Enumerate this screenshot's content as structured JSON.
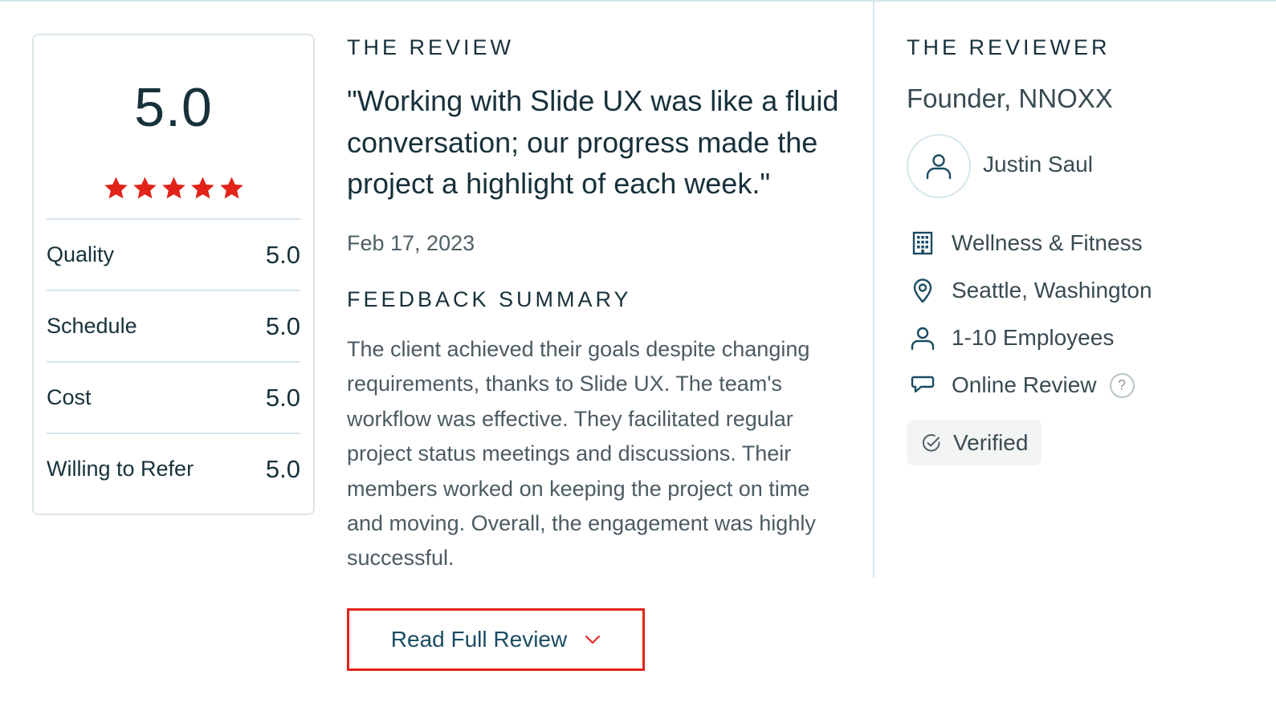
{
  "rating": {
    "overall": "5.0",
    "stars": 5,
    "star_color": "#e2231a",
    "scores": [
      {
        "label": "Quality",
        "value": "5.0"
      },
      {
        "label": "Schedule",
        "value": "5.0"
      },
      {
        "label": "Cost",
        "value": "5.0"
      },
      {
        "label": "Willing to Refer",
        "value": "5.0"
      }
    ]
  },
  "review": {
    "heading": "THE REVIEW",
    "quote": "\"Working with Slide UX was like a fluid conversation; our progress made the project a highlight of each week.\"",
    "date": "Feb 17, 2023",
    "summary_heading": "FEEDBACK SUMMARY",
    "summary": "The client achieved their goals despite changing requirements, thanks to Slide UX. The team's workflow was effective. They facilitated regular project status meetings and discussions. Their members worked on keeping the project on time and moving. Overall, the engagement was highly successful.",
    "read_full_label": "Read Full Review",
    "button_border_color": "#e2231a"
  },
  "reviewer": {
    "heading": "THE REVIEWER",
    "title": "Founder, NNOXX",
    "name": "Justin Saul",
    "industry": {
      "icon": "building-icon",
      "text": "Wellness & Fitness"
    },
    "location": {
      "icon": "map-pin-icon",
      "text": "Seattle, Washington"
    },
    "company_size": {
      "icon": "user-icon",
      "text": "1-10 Employees"
    },
    "review_type": {
      "icon": "speech-bubble-icon",
      "text": "Online Review",
      "help": "?"
    },
    "verified_label": "Verified"
  }
}
